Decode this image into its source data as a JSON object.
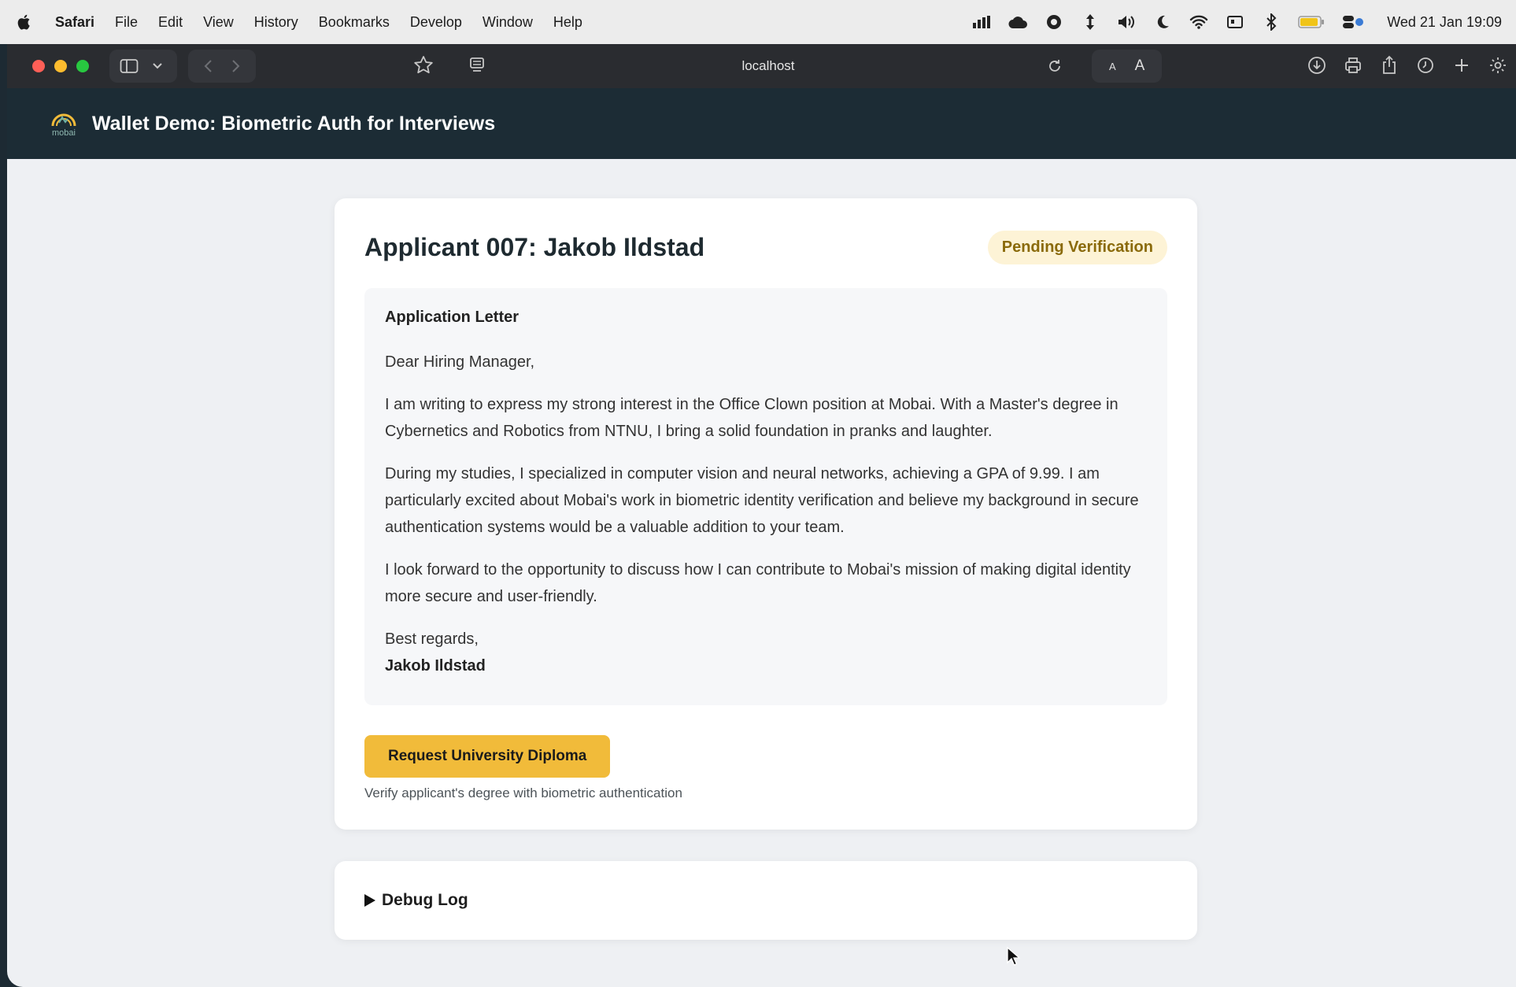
{
  "menubar": {
    "app_name": "Safari",
    "items": [
      "File",
      "Edit",
      "View",
      "History",
      "Bookmarks",
      "Develop",
      "Window",
      "Help"
    ],
    "clock": "Wed 21 Jan  19:09",
    "status_icons": [
      "bar-chart-icon",
      "cloud-icon",
      "paw-icon",
      "arrow-icon",
      "volume-icon",
      "moon-icon",
      "wifi-icon",
      "display-icon",
      "bluetooth-icon",
      "battery-icon",
      "control-center-icon"
    ]
  },
  "browser": {
    "address": "localhost",
    "text_size_small": "A",
    "text_size_large": "A"
  },
  "header": {
    "logo_text": "mobai",
    "title": "Wallet Demo: Biometric Auth for Interviews"
  },
  "applicant": {
    "title": "Applicant 007: Jakob Ildstad",
    "status": "Pending Verification"
  },
  "letter": {
    "heading": "Application Letter",
    "greeting": "Dear Hiring Manager,",
    "paragraphs": [
      "I am writing to express my strong interest in the Office Clown position at Mobai. With a Master's degree in Cybernetics and Robotics from NTNU, I bring a solid foundation in pranks and laughter.",
      "During my studies, I specialized in computer vision and neural networks, achieving a GPA of 9.99. I am particularly excited about Mobai's work in biometric identity verification and believe my background in secure authentication systems would be a valuable addition to your team.",
      "I look forward to the opportunity to discuss how I can contribute to Mobai's mission of making digital identity more secure and user-friendly."
    ],
    "closing": "Best regards,",
    "signature": "Jakob Ildstad"
  },
  "actions": {
    "request_button": "Request University Diploma",
    "helper": "Verify applicant's degree with biometric authentication"
  },
  "debug": {
    "label": "Debug Log"
  },
  "colors": {
    "header_bg": "#1c2c35",
    "button_bg": "#f1bb3a",
    "badge_bg": "#fdf3d6",
    "badge_text": "#8a6a0a"
  }
}
